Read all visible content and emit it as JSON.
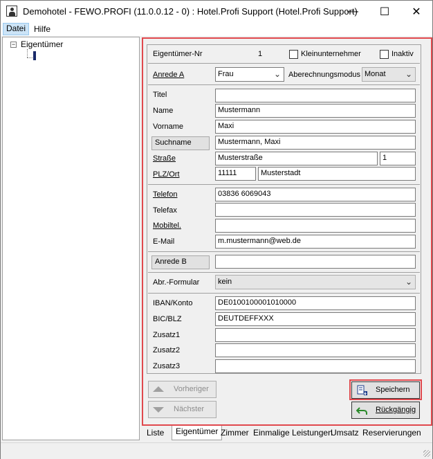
{
  "window": {
    "title": "Demohotel - FEWO.PROFI (11.0.0.12 - 0) : Hotel.Profi Support (Hotel.Profi Support)",
    "minimize_glyph": "—",
    "maximize_glyph": "☐",
    "close_glyph": "✕"
  },
  "menu": {
    "items": [
      "Datei",
      "Hilfe"
    ]
  },
  "tree": {
    "root_label": "Eigentümer",
    "expander_glyph": "−"
  },
  "form": {
    "owner_no_label": "Eigentümer-Nr",
    "owner_no_value": "1",
    "kleinunternehmer_label": "Kleinunternehmer",
    "kleinunternehmer_checked": false,
    "inaktiv_label": "Inaktiv",
    "inaktiv_checked": false,
    "anrede_a_label": "Anrede A",
    "anrede_a_value": "Frau",
    "abrechnungsmodus_label": "Aberechnungsmodus",
    "abrechnungsmodus_value": "Monat",
    "titel_label": "Titel",
    "titel_value": "",
    "name_label": "Name",
    "name_value": "Mustermann",
    "vorname_label": "Vorname",
    "vorname_value": "Maxi",
    "suchname_label": "Suchname",
    "suchname_value": "Mustermann, Maxi",
    "strasse_label": "Straße",
    "strasse_value": "Musterstraße",
    "hausnr_value": "1",
    "plz_ort_label": "PLZ/Ort",
    "plz_value": "11111",
    "ort_value": "Musterstadt",
    "telefon_label": "Telefon",
    "telefon_value": "03836 6069043",
    "telefax_label": "Telefax",
    "telefax_value": "",
    "mobiltel_label": "Mobiltel.",
    "mobiltel_value": "",
    "email_label": "E-Mail",
    "email_value": "m.mustermann@web.de",
    "anrede_b_label": "Anrede B",
    "anrede_b_value": "",
    "abr_formular_label": "Abr.-Formular",
    "abr_formular_value": "kein",
    "iban_label": "IBAN/Konto",
    "iban_value": "DE0100100001010000",
    "bic_label": "BIC/BLZ",
    "bic_value": "DEUTDEFFXXX",
    "zusatz1_label": "Zusatz1",
    "zusatz1_value": "",
    "zusatz2_label": "Zusatz2",
    "zusatz2_value": "",
    "zusatz3_label": "Zusatz3",
    "zusatz3_value": ""
  },
  "buttons": {
    "vorheriger": "Vorheriger",
    "naechster": "Nächster",
    "speichern": "Speichern",
    "rueckgaengig": "Rückgängig"
  },
  "tabs": [
    "Liste",
    "Eigentümer",
    "Zimmer",
    "Einmalige Leistungen",
    "Umsatz",
    "Reservierungen"
  ],
  "active_tab": "Eigentümer",
  "colors": {
    "highlight": "#e0484d",
    "undo_icon": "#2a8a2a",
    "save_icon": "#1a3a8a"
  }
}
